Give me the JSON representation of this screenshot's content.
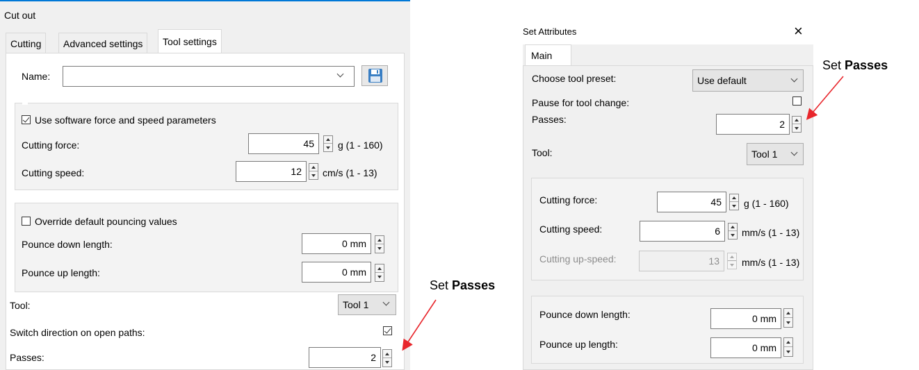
{
  "left_dialog": {
    "title": "Cut out",
    "tabs": [
      "Cutting",
      "Advanced settings",
      "Tool settings"
    ],
    "name_label": "Name:",
    "name_value": "",
    "force_speed": {
      "checkbox_label": "Use software force and speed parameters",
      "checked": true,
      "cutting_force_label": "Cutting force:",
      "cutting_force_value": "45",
      "cutting_force_unit": "g (1 - 160)",
      "cutting_speed_label": "Cutting speed:",
      "cutting_speed_value": "12",
      "cutting_speed_unit": "cm/s (1 - 13)"
    },
    "pouncing": {
      "checkbox_label": "Override default pouncing values",
      "checked": false,
      "down_label": "Pounce down length:",
      "down_value": "0 mm",
      "up_label": "Pounce up length:",
      "up_value": "0 mm"
    },
    "tool_label": "Tool:",
    "tool_value": "Tool 1",
    "switch_label": "Switch direction on open paths:",
    "switch_checked": true,
    "passes_label": "Passes:",
    "passes_value": "2"
  },
  "right_dialog": {
    "title": "Set Attributes",
    "close_glyph": "×",
    "tabs": [
      "Main"
    ],
    "preset_label": "Choose tool preset:",
    "preset_value": "Use default",
    "pause_label": "Pause for tool change:",
    "pause_checked": false,
    "passes_label": "Passes:",
    "passes_value": "2",
    "tool_label": "Tool:",
    "tool_value": "Tool 1",
    "cutting_force_label": "Cutting force:",
    "cutting_force_value": "45",
    "cutting_force_unit": "g (1 - 160)",
    "cutting_speed_label": "Cutting speed:",
    "cutting_speed_value": "6",
    "cutting_speed_unit": "mm/s (1 - 13)",
    "up_speed_label": "Cutting up-speed:",
    "up_speed_value": "13",
    "up_speed_unit": "mm/s (1 - 13)",
    "pounce_down_label": "Pounce down length:",
    "pounce_down_value": "0 mm",
    "pounce_up_label": "Pounce up length:",
    "pounce_up_value": "0 mm"
  },
  "annotations": {
    "left_prefix": "Set ",
    "left_bold": "Passes",
    "right_prefix": "Set ",
    "right_bold": "Passes",
    "arrow_color": "#e8262c"
  },
  "icons": {
    "save": "floppy-disk-icon"
  },
  "colors": {
    "accent": "#0078d7"
  }
}
